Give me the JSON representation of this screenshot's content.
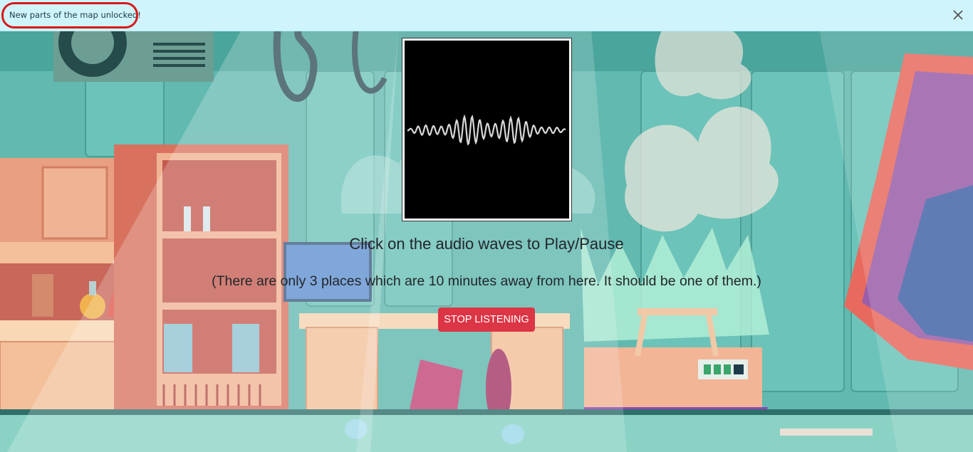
{
  "notification": {
    "message": "New parts of the map unlocked!",
    "close_icon": "close-icon"
  },
  "player": {
    "icon": "audio-waveform-icon"
  },
  "instruction": "Click on the audio waves to Play/Pause",
  "hint": "(There are only 3 places which are 10 minutes away from here. It should be one of them.)",
  "stop_button": {
    "label": "STOP LISTENING"
  },
  "colors": {
    "notification_bg": "#cff4fc",
    "highlight_ring": "#d71a1a",
    "stop_button": "#dc3545",
    "scene_teal": "#5fb6ad"
  }
}
